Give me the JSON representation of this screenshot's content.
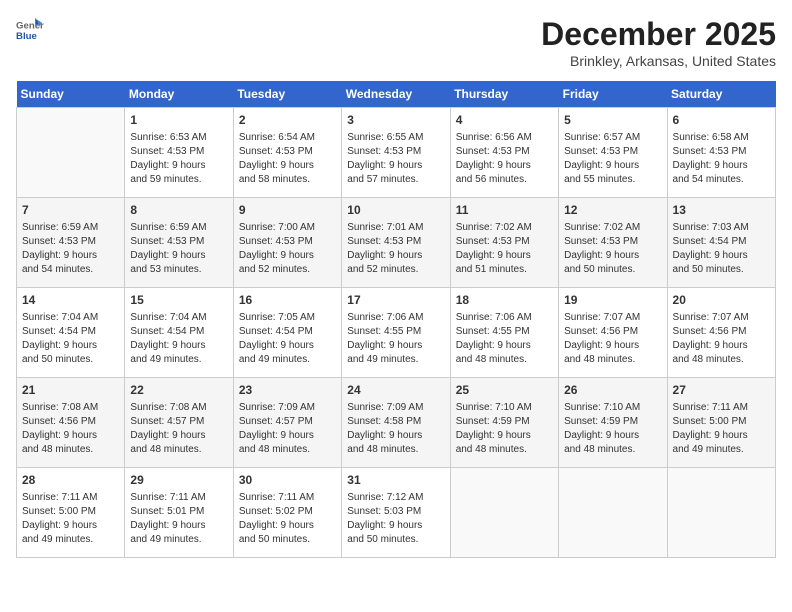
{
  "header": {
    "logo_general": "General",
    "logo_blue": "Blue",
    "month_title": "December 2025",
    "subtitle": "Brinkley, Arkansas, United States"
  },
  "weekdays": [
    "Sunday",
    "Monday",
    "Tuesday",
    "Wednesday",
    "Thursday",
    "Friday",
    "Saturday"
  ],
  "weeks": [
    [
      {
        "day": "",
        "info": ""
      },
      {
        "day": "1",
        "info": "Sunrise: 6:53 AM\nSunset: 4:53 PM\nDaylight: 9 hours\nand 59 minutes."
      },
      {
        "day": "2",
        "info": "Sunrise: 6:54 AM\nSunset: 4:53 PM\nDaylight: 9 hours\nand 58 minutes."
      },
      {
        "day": "3",
        "info": "Sunrise: 6:55 AM\nSunset: 4:53 PM\nDaylight: 9 hours\nand 57 minutes."
      },
      {
        "day": "4",
        "info": "Sunrise: 6:56 AM\nSunset: 4:53 PM\nDaylight: 9 hours\nand 56 minutes."
      },
      {
        "day": "5",
        "info": "Sunrise: 6:57 AM\nSunset: 4:53 PM\nDaylight: 9 hours\nand 55 minutes."
      },
      {
        "day": "6",
        "info": "Sunrise: 6:58 AM\nSunset: 4:53 PM\nDaylight: 9 hours\nand 54 minutes."
      }
    ],
    [
      {
        "day": "7",
        "info": "Sunrise: 6:59 AM\nSunset: 4:53 PM\nDaylight: 9 hours\nand 54 minutes."
      },
      {
        "day": "8",
        "info": "Sunrise: 6:59 AM\nSunset: 4:53 PM\nDaylight: 9 hours\nand 53 minutes."
      },
      {
        "day": "9",
        "info": "Sunrise: 7:00 AM\nSunset: 4:53 PM\nDaylight: 9 hours\nand 52 minutes."
      },
      {
        "day": "10",
        "info": "Sunrise: 7:01 AM\nSunset: 4:53 PM\nDaylight: 9 hours\nand 52 minutes."
      },
      {
        "day": "11",
        "info": "Sunrise: 7:02 AM\nSunset: 4:53 PM\nDaylight: 9 hours\nand 51 minutes."
      },
      {
        "day": "12",
        "info": "Sunrise: 7:02 AM\nSunset: 4:53 PM\nDaylight: 9 hours\nand 50 minutes."
      },
      {
        "day": "13",
        "info": "Sunrise: 7:03 AM\nSunset: 4:54 PM\nDaylight: 9 hours\nand 50 minutes."
      }
    ],
    [
      {
        "day": "14",
        "info": "Sunrise: 7:04 AM\nSunset: 4:54 PM\nDaylight: 9 hours\nand 50 minutes."
      },
      {
        "day": "15",
        "info": "Sunrise: 7:04 AM\nSunset: 4:54 PM\nDaylight: 9 hours\nand 49 minutes."
      },
      {
        "day": "16",
        "info": "Sunrise: 7:05 AM\nSunset: 4:54 PM\nDaylight: 9 hours\nand 49 minutes."
      },
      {
        "day": "17",
        "info": "Sunrise: 7:06 AM\nSunset: 4:55 PM\nDaylight: 9 hours\nand 49 minutes."
      },
      {
        "day": "18",
        "info": "Sunrise: 7:06 AM\nSunset: 4:55 PM\nDaylight: 9 hours\nand 48 minutes."
      },
      {
        "day": "19",
        "info": "Sunrise: 7:07 AM\nSunset: 4:56 PM\nDaylight: 9 hours\nand 48 minutes."
      },
      {
        "day": "20",
        "info": "Sunrise: 7:07 AM\nSunset: 4:56 PM\nDaylight: 9 hours\nand 48 minutes."
      }
    ],
    [
      {
        "day": "21",
        "info": "Sunrise: 7:08 AM\nSunset: 4:56 PM\nDaylight: 9 hours\nand 48 minutes."
      },
      {
        "day": "22",
        "info": "Sunrise: 7:08 AM\nSunset: 4:57 PM\nDaylight: 9 hours\nand 48 minutes."
      },
      {
        "day": "23",
        "info": "Sunrise: 7:09 AM\nSunset: 4:57 PM\nDaylight: 9 hours\nand 48 minutes."
      },
      {
        "day": "24",
        "info": "Sunrise: 7:09 AM\nSunset: 4:58 PM\nDaylight: 9 hours\nand 48 minutes."
      },
      {
        "day": "25",
        "info": "Sunrise: 7:10 AM\nSunset: 4:59 PM\nDaylight: 9 hours\nand 48 minutes."
      },
      {
        "day": "26",
        "info": "Sunrise: 7:10 AM\nSunset: 4:59 PM\nDaylight: 9 hours\nand 48 minutes."
      },
      {
        "day": "27",
        "info": "Sunrise: 7:11 AM\nSunset: 5:00 PM\nDaylight: 9 hours\nand 49 minutes."
      }
    ],
    [
      {
        "day": "28",
        "info": "Sunrise: 7:11 AM\nSunset: 5:00 PM\nDaylight: 9 hours\nand 49 minutes."
      },
      {
        "day": "29",
        "info": "Sunrise: 7:11 AM\nSunset: 5:01 PM\nDaylight: 9 hours\nand 49 minutes."
      },
      {
        "day": "30",
        "info": "Sunrise: 7:11 AM\nSunset: 5:02 PM\nDaylight: 9 hours\nand 50 minutes."
      },
      {
        "day": "31",
        "info": "Sunrise: 7:12 AM\nSunset: 5:03 PM\nDaylight: 9 hours\nand 50 minutes."
      },
      {
        "day": "",
        "info": ""
      },
      {
        "day": "",
        "info": ""
      },
      {
        "day": "",
        "info": ""
      }
    ]
  ]
}
